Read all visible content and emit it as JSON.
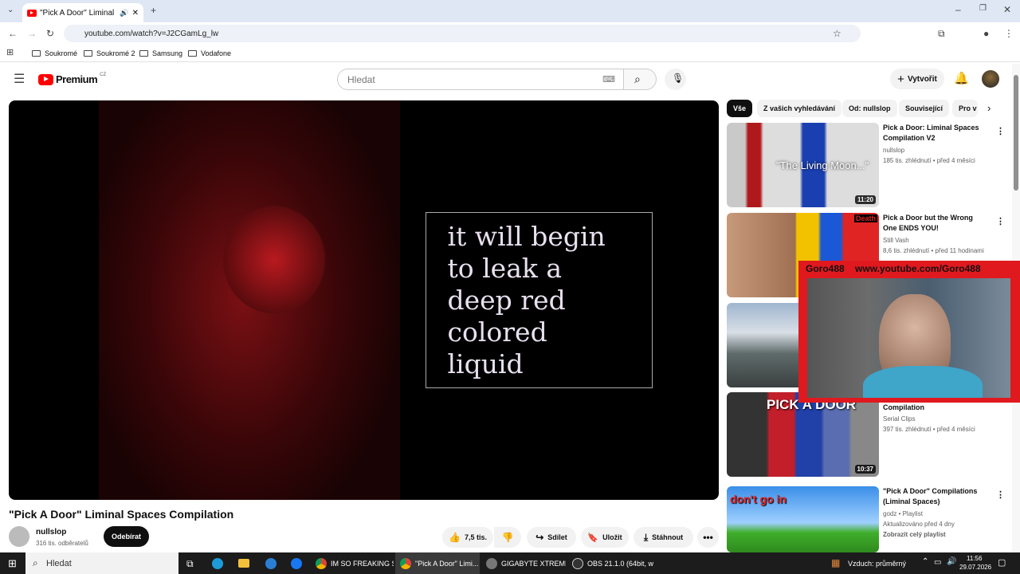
{
  "browser": {
    "tab_title": "\"Pick A Door\" Liminal Spaces",
    "url": "youtube.com/watch?v=J2CGamLg_lw",
    "bookmarks": [
      "Soukromé",
      "Soukromé 2",
      "Samsung",
      "Vodafone"
    ]
  },
  "youtube": {
    "logo": "Premium",
    "region": "CZ",
    "search_placeholder": "Hledat",
    "create_label": "Vytvořit"
  },
  "video": {
    "caption": "it will begin to leak a deep red colored liquid",
    "title": "\"Pick A Door\" Liminal Spaces Compilation",
    "channel": "nullslop",
    "subscribers": "316 tis. odběratelů",
    "subscribe_label": "Odebírat",
    "likes": "7,5 tis.",
    "share_label": "Sdílet",
    "save_label": "Uložit",
    "download_label": "Stáhnout"
  },
  "chips": [
    "Vše",
    "Z vašich vyhledávání",
    "Od: nullslop",
    "Související",
    "Pro v"
  ],
  "recommendations": [
    {
      "title": "Pick a Door: Liminal Spaces Compilation V2",
      "channel": "nullslop",
      "meta": "185 tis. zhlédnutí • před 4 měsíci",
      "duration": "11:20",
      "thumb_text": "\"The Living Moon...\""
    },
    {
      "title": "Pick a Door but the Wrong One ENDS YOU!",
      "channel": "Still Vash",
      "meta": "8,6 tis. zhlédnutí • před 11 hodinami",
      "duration": "",
      "thumb_text": "Death"
    },
    {
      "title": "",
      "channel": "",
      "meta": "",
      "duration": "",
      "thumb_text": ""
    },
    {
      "title": "Compilation",
      "channel": "Serial Clips",
      "meta": "397 tis. zhlédnutí • před 4 měsíci",
      "duration": "10:37",
      "thumb_text": "PICK A DOOR"
    },
    {
      "title": "\"Pick A Door\" Compilations (Liminal Spaces)",
      "channel": "godz • Playlist",
      "meta": "Aktualizováno před 4 dny",
      "extra": "Zobrazit celý playlist",
      "duration": "",
      "thumb_text": "don't go in"
    }
  ],
  "overlay": {
    "name": "Goro488",
    "url": "www.youtube.com/Goro488"
  },
  "taskbar": {
    "search": "Hledat",
    "apps": [
      "IM SO FREAKING S...",
      "\"Pick A Door\" Limi...",
      "GIGABYTE XTREME ...",
      "OBS 21.1.0 (64bit, w..."
    ],
    "weather": "Vzduch: průměrný",
    "time": "11:56",
    "date": "29.07.2026"
  },
  "colors": {
    "accent": "#ff0000",
    "overlay": "#e0191f"
  }
}
